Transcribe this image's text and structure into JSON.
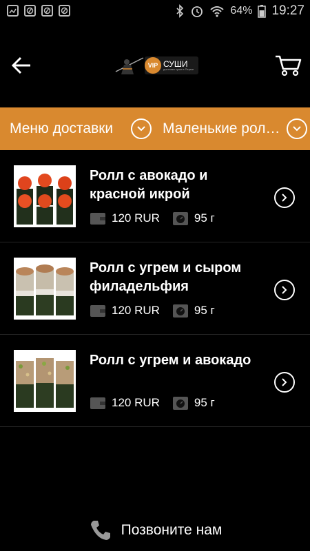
{
  "status_bar": {
    "battery": "64%",
    "time": "19:27",
    "icons": [
      "image-icon",
      "app-icon",
      "app-icon",
      "app-icon",
      "bluetooth-icon",
      "alarm-icon",
      "wifi-icon",
      "battery-icon"
    ]
  },
  "header": {
    "logo_badge": "VIP",
    "logo_name": "СУШИ",
    "logo_sub": "доставка суши в Перми"
  },
  "filters": {
    "menu_label": "Меню доставки",
    "category_label": "Маленькие роллы"
  },
  "colors": {
    "accent": "#d9892f",
    "background": "#000000"
  },
  "products": [
    {
      "title": "Ролл с авокадо и красной икрой",
      "price": "120 RUR",
      "weight": "95 г"
    },
    {
      "title": "Ролл с угрем и сыром филадельфия",
      "price": "120 RUR",
      "weight": "95 г"
    },
    {
      "title": "Ролл с угрем и авокадо",
      "price": "120 RUR",
      "weight": "95 г"
    }
  ],
  "footer": {
    "call_label": "Позвоните нам"
  }
}
